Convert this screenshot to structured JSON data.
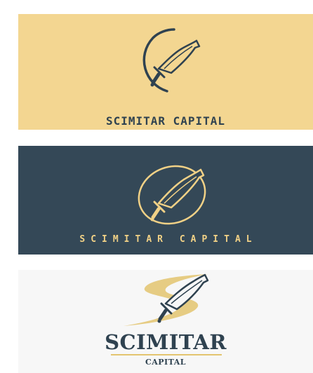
{
  "panels": [
    {
      "background": "#f3d691",
      "accent": "#2f4250",
      "icon": "scimitar-crescent-icon",
      "wordmark": "SCIMITAR CAPITAL"
    },
    {
      "background": "#344857",
      "accent": "#f1d186",
      "icon": "scimitar-orbit-icon",
      "wordmark": "SCIMITAR CAPITAL"
    },
    {
      "background": "#f7f7f7",
      "accent": "#2f4250",
      "swoosh_color": "#e3c46f",
      "icon": "scimitar-swoosh-icon",
      "wordmark": "SCIMITAR",
      "subtitle": "CAPITAL"
    }
  ]
}
